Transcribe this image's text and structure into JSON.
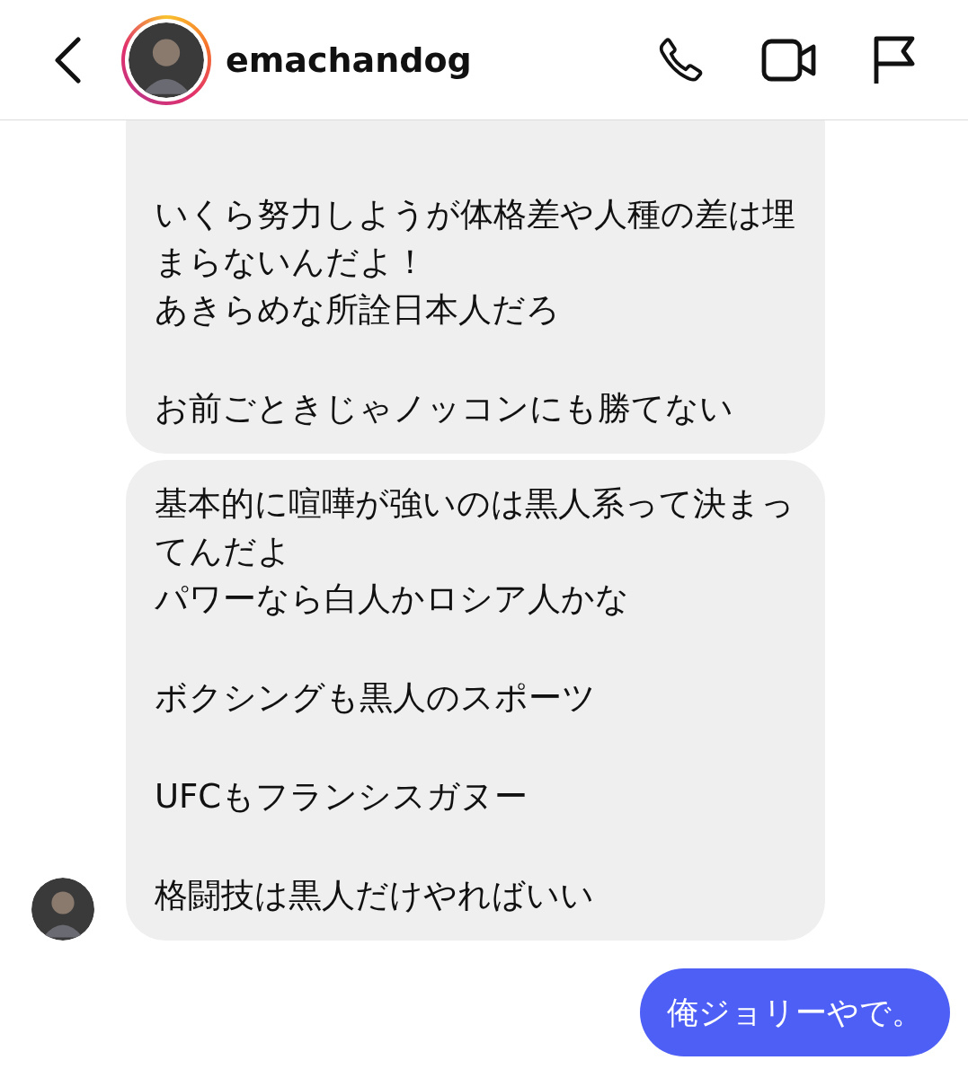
{
  "header": {
    "username": "emachandog",
    "story_ring": true
  },
  "messages": [
    {
      "kind": "received",
      "avatar": false,
      "paragraphs": [
        [
          "いくら努力しようが体格差や人種の差は埋まらないんだよ！",
          "あきらめな所詮日本人だろ"
        ],
        [
          "お前ごときじゃノッコンにも勝てない"
        ]
      ]
    },
    {
      "kind": "received",
      "avatar": true,
      "paragraphs": [
        [
          "基本的に喧嘩が強いのは黒人系って決まってんだよ",
          "パワーなら白人かロシア人かな"
        ],
        [
          "ボクシングも黒人のスポーツ"
        ],
        [
          "UFCもフランシスガヌー"
        ],
        [
          "格闘技は黒人だけやればいい"
        ]
      ]
    },
    {
      "kind": "sent",
      "paragraphs": [
        [
          "俺ジョリーやで。"
        ]
      ]
    }
  ]
}
